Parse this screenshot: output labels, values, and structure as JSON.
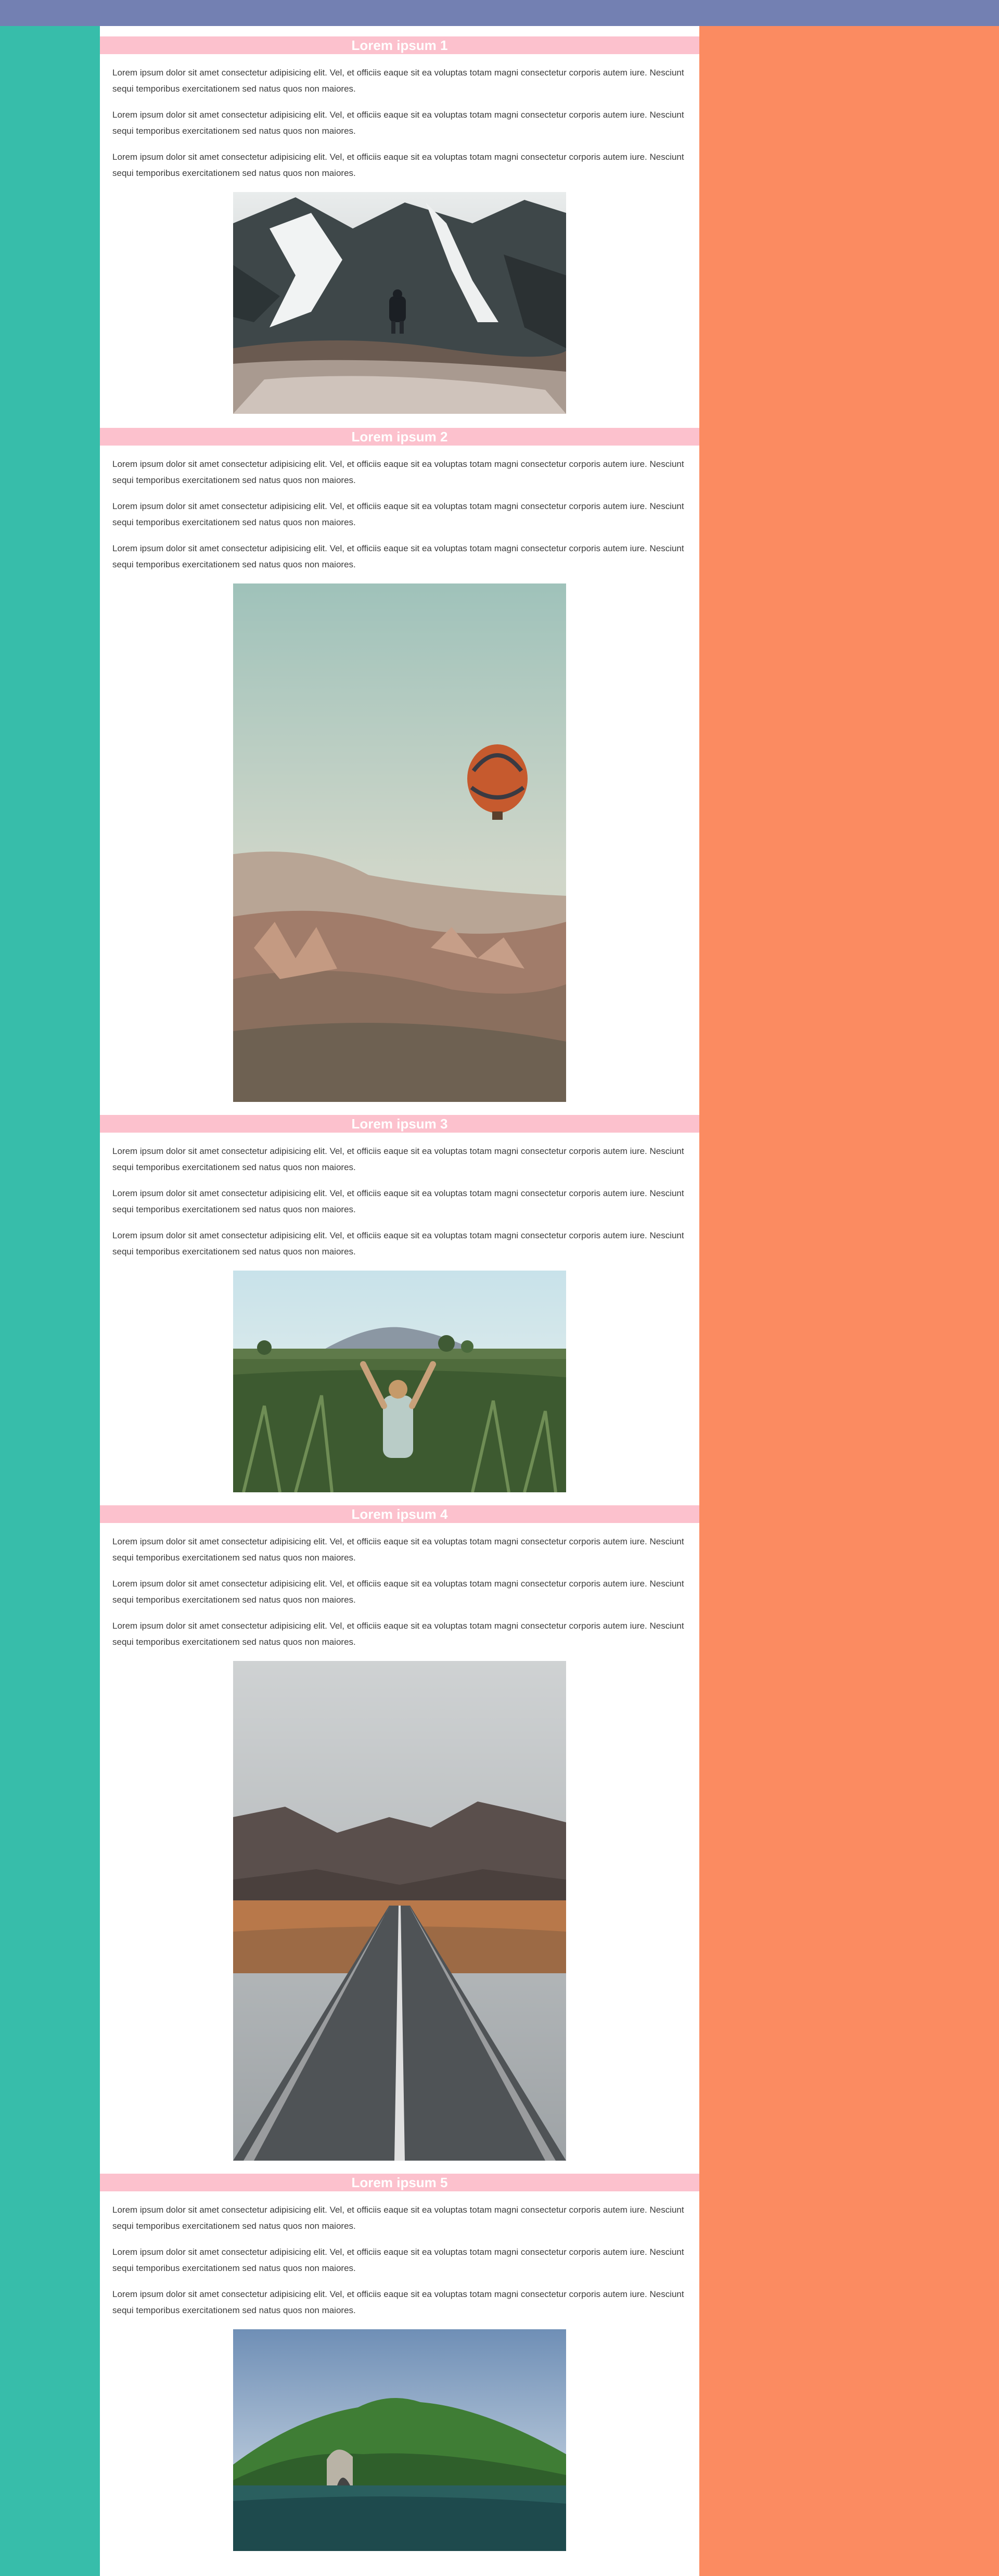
{
  "sections": [
    {
      "title": "Lorem ipsum 1",
      "paragraphs": [
        "Lorem ipsum dolor sit amet consectetur adipisicing elit. Vel, et officiis eaque sit ea voluptas totam magni consectetur corporis autem iure. Nesciunt sequi temporibus exercitationem sed natus quos non maiores.",
        "Lorem ipsum dolor sit amet consectetur adipisicing elit. Vel, et officiis eaque sit ea voluptas totam magni consectetur corporis autem iure. Nesciunt sequi temporibus exercitationem sed natus quos non maiores.",
        "Lorem ipsum dolor sit amet consectetur adipisicing elit. Vel, et officiis eaque sit ea voluptas totam magni consectetur corporis autem iure. Nesciunt sequi temporibus exercitationem sed natus quos non maiores."
      ]
    },
    {
      "title": "Lorem ipsum 2",
      "paragraphs": [
        "Lorem ipsum dolor sit amet consectetur adipisicing elit. Vel, et officiis eaque sit ea voluptas totam magni consectetur corporis autem iure. Nesciunt sequi temporibus exercitationem sed natus quos non maiores.",
        "Lorem ipsum dolor sit amet consectetur adipisicing elit. Vel, et officiis eaque sit ea voluptas totam magni consectetur corporis autem iure. Nesciunt sequi temporibus exercitationem sed natus quos non maiores.",
        "Lorem ipsum dolor sit amet consectetur adipisicing elit. Vel, et officiis eaque sit ea voluptas totam magni consectetur corporis autem iure. Nesciunt sequi temporibus exercitationem sed natus quos non maiores."
      ]
    },
    {
      "title": "Lorem ipsum 3",
      "paragraphs": [
        "Lorem ipsum dolor sit amet consectetur adipisicing elit. Vel, et officiis eaque sit ea voluptas totam magni consectetur corporis autem iure. Nesciunt sequi temporibus exercitationem sed natus quos non maiores.",
        "Lorem ipsum dolor sit amet consectetur adipisicing elit. Vel, et officiis eaque sit ea voluptas totam magni consectetur corporis autem iure. Nesciunt sequi temporibus exercitationem sed natus quos non maiores.",
        "Lorem ipsum dolor sit amet consectetur adipisicing elit. Vel, et officiis eaque sit ea voluptas totam magni consectetur corporis autem iure. Nesciunt sequi temporibus exercitationem sed natus quos non maiores."
      ]
    },
    {
      "title": "Lorem ipsum 4",
      "paragraphs": [
        "Lorem ipsum dolor sit amet consectetur adipisicing elit. Vel, et officiis eaque sit ea voluptas totam magni consectetur corporis autem iure. Nesciunt sequi temporibus exercitationem sed natus quos non maiores.",
        "Lorem ipsum dolor sit amet consectetur adipisicing elit. Vel, et officiis eaque sit ea voluptas totam magni consectetur corporis autem iure. Nesciunt sequi temporibus exercitationem sed natus quos non maiores.",
        "Lorem ipsum dolor sit amet consectetur adipisicing elit. Vel, et officiis eaque sit ea voluptas totam magni consectetur corporis autem iure. Nesciunt sequi temporibus exercitationem sed natus quos non maiores."
      ]
    },
    {
      "title": "Lorem ipsum 5",
      "paragraphs": [
        "Lorem ipsum dolor sit amet consectetur adipisicing elit. Vel, et officiis eaque sit ea voluptas totam magni consectetur corporis autem iure. Nesciunt sequi temporibus exercitationem sed natus quos non maiores.",
        "Lorem ipsum dolor sit amet consectetur adipisicing elit. Vel, et officiis eaque sit ea voluptas totam magni consectetur corporis autem iure. Nesciunt sequi temporibus exercitationem sed natus quos non maiores.",
        "Lorem ipsum dolor sit amet consectetur adipisicing elit. Vel, et officiis eaque sit ea voluptas totam magni consectetur corporis autem iure. Nesciunt sequi temporibus exercitationem sed natus quos non maiores."
      ]
    }
  ],
  "colors": {
    "topbar": "#7380b2",
    "left_panel": "#37bdaa",
    "right_panel": "#fb8b61",
    "section_header": "#fcc1cd",
    "section_header_text": "#ffffff",
    "body_text": "#3c3c3c"
  }
}
